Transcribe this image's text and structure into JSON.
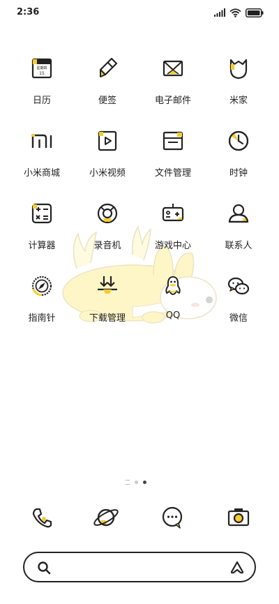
{
  "status_bar": {
    "time": "2:36"
  },
  "accent_color": "#f6cc2e",
  "apps": [
    {
      "label": "日历",
      "icon": "calendar-icon",
      "calendar_text": "星期四",
      "calendar_day": "15"
    },
    {
      "label": "便签",
      "icon": "notes-icon"
    },
    {
      "label": "电子邮件",
      "icon": "email-icon"
    },
    {
      "label": "米家",
      "icon": "mijia-icon"
    },
    {
      "label": "小米商城",
      "icon": "mi-store-icon"
    },
    {
      "label": "小米视频",
      "icon": "video-icon"
    },
    {
      "label": "文件管理",
      "icon": "file-manager-icon"
    },
    {
      "label": "时钟",
      "icon": "clock-icon"
    },
    {
      "label": "计算器",
      "icon": "calculator-icon"
    },
    {
      "label": "录音机",
      "icon": "recorder-icon"
    },
    {
      "label": "游戏中心",
      "icon": "game-center-icon"
    },
    {
      "label": "联系人",
      "icon": "contacts-icon"
    },
    {
      "label": "指南针",
      "icon": "compass-icon"
    },
    {
      "label": "下载管理",
      "icon": "download-icon"
    },
    {
      "label": "QQ",
      "icon": "qq-icon"
    },
    {
      "label": "微信",
      "icon": "wechat-icon"
    }
  ],
  "page_indicator": {
    "pages": 3,
    "current": 3
  },
  "dock": [
    {
      "icon": "phone-icon"
    },
    {
      "icon": "browser-icon"
    },
    {
      "icon": "messages-icon"
    },
    {
      "icon": "camera-icon"
    }
  ],
  "search_bar": {
    "icon": "search-icon",
    "assistant_icon": "assistant-icon"
  }
}
